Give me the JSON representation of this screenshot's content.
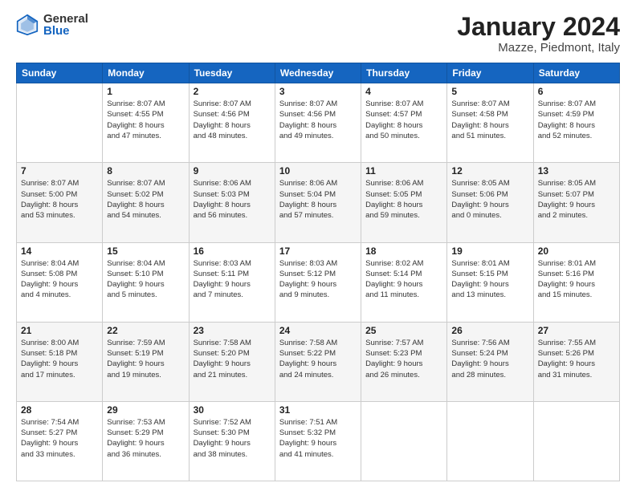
{
  "logo": {
    "general": "General",
    "blue": "Blue"
  },
  "header": {
    "month": "January 2024",
    "location": "Mazze, Piedmont, Italy"
  },
  "weekdays": [
    "Sunday",
    "Monday",
    "Tuesday",
    "Wednesday",
    "Thursday",
    "Friday",
    "Saturday"
  ],
  "weeks": [
    [
      {
        "day": "",
        "info": ""
      },
      {
        "day": "1",
        "info": "Sunrise: 8:07 AM\nSunset: 4:55 PM\nDaylight: 8 hours\nand 47 minutes."
      },
      {
        "day": "2",
        "info": "Sunrise: 8:07 AM\nSunset: 4:56 PM\nDaylight: 8 hours\nand 48 minutes."
      },
      {
        "day": "3",
        "info": "Sunrise: 8:07 AM\nSunset: 4:56 PM\nDaylight: 8 hours\nand 49 minutes."
      },
      {
        "day": "4",
        "info": "Sunrise: 8:07 AM\nSunset: 4:57 PM\nDaylight: 8 hours\nand 50 minutes."
      },
      {
        "day": "5",
        "info": "Sunrise: 8:07 AM\nSunset: 4:58 PM\nDaylight: 8 hours\nand 51 minutes."
      },
      {
        "day": "6",
        "info": "Sunrise: 8:07 AM\nSunset: 4:59 PM\nDaylight: 8 hours\nand 52 minutes."
      }
    ],
    [
      {
        "day": "7",
        "info": "Sunrise: 8:07 AM\nSunset: 5:00 PM\nDaylight: 8 hours\nand 53 minutes."
      },
      {
        "day": "8",
        "info": "Sunrise: 8:07 AM\nSunset: 5:02 PM\nDaylight: 8 hours\nand 54 minutes."
      },
      {
        "day": "9",
        "info": "Sunrise: 8:06 AM\nSunset: 5:03 PM\nDaylight: 8 hours\nand 56 minutes."
      },
      {
        "day": "10",
        "info": "Sunrise: 8:06 AM\nSunset: 5:04 PM\nDaylight: 8 hours\nand 57 minutes."
      },
      {
        "day": "11",
        "info": "Sunrise: 8:06 AM\nSunset: 5:05 PM\nDaylight: 8 hours\nand 59 minutes."
      },
      {
        "day": "12",
        "info": "Sunrise: 8:05 AM\nSunset: 5:06 PM\nDaylight: 9 hours\nand 0 minutes."
      },
      {
        "day": "13",
        "info": "Sunrise: 8:05 AM\nSunset: 5:07 PM\nDaylight: 9 hours\nand 2 minutes."
      }
    ],
    [
      {
        "day": "14",
        "info": "Sunrise: 8:04 AM\nSunset: 5:08 PM\nDaylight: 9 hours\nand 4 minutes."
      },
      {
        "day": "15",
        "info": "Sunrise: 8:04 AM\nSunset: 5:10 PM\nDaylight: 9 hours\nand 5 minutes."
      },
      {
        "day": "16",
        "info": "Sunrise: 8:03 AM\nSunset: 5:11 PM\nDaylight: 9 hours\nand 7 minutes."
      },
      {
        "day": "17",
        "info": "Sunrise: 8:03 AM\nSunset: 5:12 PM\nDaylight: 9 hours\nand 9 minutes."
      },
      {
        "day": "18",
        "info": "Sunrise: 8:02 AM\nSunset: 5:14 PM\nDaylight: 9 hours\nand 11 minutes."
      },
      {
        "day": "19",
        "info": "Sunrise: 8:01 AM\nSunset: 5:15 PM\nDaylight: 9 hours\nand 13 minutes."
      },
      {
        "day": "20",
        "info": "Sunrise: 8:01 AM\nSunset: 5:16 PM\nDaylight: 9 hours\nand 15 minutes."
      }
    ],
    [
      {
        "day": "21",
        "info": "Sunrise: 8:00 AM\nSunset: 5:18 PM\nDaylight: 9 hours\nand 17 minutes."
      },
      {
        "day": "22",
        "info": "Sunrise: 7:59 AM\nSunset: 5:19 PM\nDaylight: 9 hours\nand 19 minutes."
      },
      {
        "day": "23",
        "info": "Sunrise: 7:58 AM\nSunset: 5:20 PM\nDaylight: 9 hours\nand 21 minutes."
      },
      {
        "day": "24",
        "info": "Sunrise: 7:58 AM\nSunset: 5:22 PM\nDaylight: 9 hours\nand 24 minutes."
      },
      {
        "day": "25",
        "info": "Sunrise: 7:57 AM\nSunset: 5:23 PM\nDaylight: 9 hours\nand 26 minutes."
      },
      {
        "day": "26",
        "info": "Sunrise: 7:56 AM\nSunset: 5:24 PM\nDaylight: 9 hours\nand 28 minutes."
      },
      {
        "day": "27",
        "info": "Sunrise: 7:55 AM\nSunset: 5:26 PM\nDaylight: 9 hours\nand 31 minutes."
      }
    ],
    [
      {
        "day": "28",
        "info": "Sunrise: 7:54 AM\nSunset: 5:27 PM\nDaylight: 9 hours\nand 33 minutes."
      },
      {
        "day": "29",
        "info": "Sunrise: 7:53 AM\nSunset: 5:29 PM\nDaylight: 9 hours\nand 36 minutes."
      },
      {
        "day": "30",
        "info": "Sunrise: 7:52 AM\nSunset: 5:30 PM\nDaylight: 9 hours\nand 38 minutes."
      },
      {
        "day": "31",
        "info": "Sunrise: 7:51 AM\nSunset: 5:32 PM\nDaylight: 9 hours\nand 41 minutes."
      },
      {
        "day": "",
        "info": ""
      },
      {
        "day": "",
        "info": ""
      },
      {
        "day": "",
        "info": ""
      }
    ]
  ]
}
